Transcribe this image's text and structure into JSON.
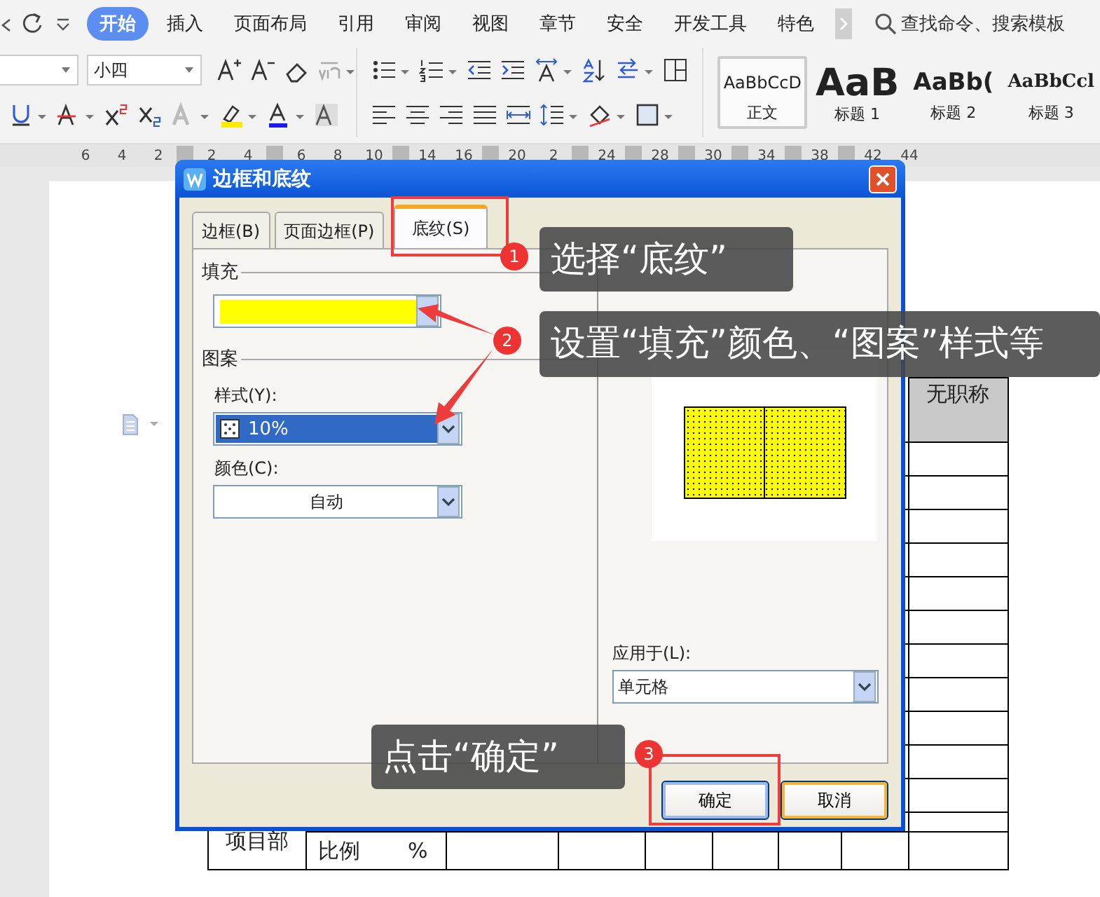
{
  "ribbon_tabs": [
    {
      "label": "开始",
      "selected": true
    },
    {
      "label": "插入",
      "selected": false
    },
    {
      "label": "页面布局",
      "selected": false
    },
    {
      "label": "引用",
      "selected": false
    },
    {
      "label": "审阅",
      "selected": false
    },
    {
      "label": "视图",
      "selected": false
    },
    {
      "label": "章节",
      "selected": false
    },
    {
      "label": "安全",
      "selected": false
    },
    {
      "label": "开发工具",
      "selected": false
    },
    {
      "label": "特色",
      "selected": false
    }
  ],
  "search": {
    "placeholder": "查找命令、搜索模板"
  },
  "font_size": "小四",
  "styles": [
    {
      "preview": "AaBbCcD",
      "label": "正文",
      "kind": "body",
      "selected": true
    },
    {
      "preview": "AaB",
      "label": "标题 1",
      "kind": "h1",
      "selected": false
    },
    {
      "preview": "AaBb(",
      "label": "标题 2",
      "kind": "h2",
      "selected": false
    },
    {
      "preview": "AaBbCcl",
      "label": "标题 3",
      "kind": "h3",
      "selected": false
    }
  ],
  "ruler": [
    {
      "kind": "number",
      "label": "6"
    },
    {
      "kind": "number",
      "label": "4"
    },
    {
      "kind": "number",
      "label": "2"
    },
    {
      "kind": "marker"
    },
    {
      "kind": "number",
      "label": "2"
    },
    {
      "kind": "number",
      "label": "4"
    },
    {
      "kind": "marker"
    },
    {
      "kind": "number",
      "label": "6"
    },
    {
      "kind": "number",
      "label": "8"
    },
    {
      "kind": "number",
      "label": "10"
    },
    {
      "kind": "marker"
    },
    {
      "kind": "number",
      "label": "14"
    },
    {
      "kind": "number",
      "label": "16"
    },
    {
      "kind": "marker"
    },
    {
      "kind": "number",
      "label": "20"
    },
    {
      "kind": "number",
      "label": "2"
    },
    {
      "kind": "marker"
    },
    {
      "kind": "number",
      "label": "24"
    },
    {
      "kind": "marker"
    },
    {
      "kind": "number",
      "label": "28"
    },
    {
      "kind": "marker"
    },
    {
      "kind": "number",
      "label": "30"
    },
    {
      "kind": "marker"
    },
    {
      "kind": "number",
      "label": "34"
    },
    {
      "kind": "marker"
    },
    {
      "kind": "number",
      "label": "38"
    },
    {
      "kind": "marker"
    },
    {
      "kind": "number",
      "label": "42"
    },
    {
      "kind": "number",
      "label": "44"
    }
  ],
  "document": {
    "header_cell": "无职称",
    "dept_cell": "项目部",
    "ratio_cell": "比例",
    "percent_cell": "%"
  },
  "dialog": {
    "title": "边框和底纹",
    "tabs": [
      {
        "label": "边框(B)",
        "selected": false
      },
      {
        "label": "页面边框(P)",
        "selected": false
      },
      {
        "label": "底纹(S)",
        "selected": true
      }
    ],
    "fill": {
      "label": "填充",
      "color": "#ffff00"
    },
    "pattern": {
      "label": "图案",
      "style_label": "样式(Y):",
      "style_value": "10%",
      "style_selected": true,
      "color_label": "颜色(C):",
      "color_value": "自动"
    },
    "apply_to": {
      "label": "应用于(L):",
      "value": "单元格"
    },
    "buttons": [
      {
        "label": "确定",
        "default": true,
        "hovered": false
      },
      {
        "label": "取消",
        "default": false,
        "hovered": true
      }
    ]
  },
  "callouts": [
    {
      "number": "1",
      "text": "选择“底纹”"
    },
    {
      "number": "2",
      "text": "设置“填充”颜色、“图案”样式等"
    },
    {
      "number": "3",
      "text": "点击“确定”"
    }
  ]
}
